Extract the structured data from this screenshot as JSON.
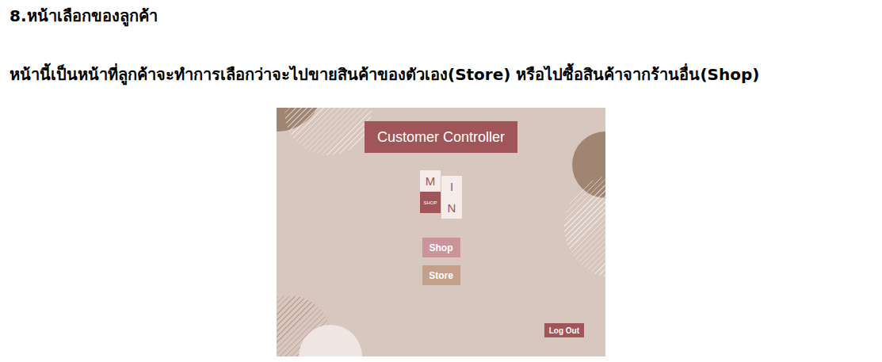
{
  "heading": "8.หน้าเลือกของลูกค้า",
  "description": "หน้านี้เป็นหน้าที่ลูกค้าจะทำการเลือกว่าจะไปขายสินค้าของตัวเอง(Store) หรือไปซื้อสินค้าจากร้านอื่น(Shop)",
  "app": {
    "title": "Customer Controller",
    "logo": {
      "columns": [
        [
          {
            "text": "M",
            "kind": "light"
          },
          {
            "text": "SHOP",
            "kind": "dark"
          }
        ],
        [
          {
            "text": "I",
            "kind": "light"
          },
          {
            "text": "N",
            "kind": "light"
          }
        ]
      ]
    },
    "buttons": [
      {
        "label": "Shop",
        "kind": "shop"
      },
      {
        "label": "Store",
        "kind": "store"
      }
    ],
    "logout": "Log Out"
  }
}
